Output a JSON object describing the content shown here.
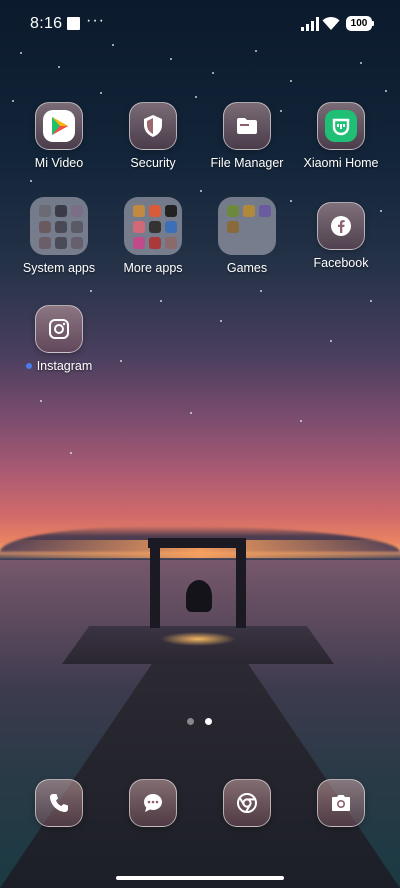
{
  "status_bar": {
    "time": "8:16",
    "more_indicator": "···",
    "battery": "100"
  },
  "apps": [
    {
      "label": "Mi Video",
      "icon": "mi-video-icon"
    },
    {
      "label": "Security",
      "icon": "shield-icon"
    },
    {
      "label": "File Manager",
      "icon": "folder-icon"
    },
    {
      "label": "Xiaomi Home",
      "icon": "xiaomi-home-icon"
    },
    {
      "label": "System apps",
      "icon": "folder-grid-icon"
    },
    {
      "label": "More apps",
      "icon": "folder-grid-icon"
    },
    {
      "label": "Games",
      "icon": "folder-grid-icon"
    },
    {
      "label": "Facebook",
      "icon": "facebook-icon"
    },
    {
      "label": "Instagram",
      "icon": "instagram-icon",
      "new_badge": true
    }
  ],
  "dock": [
    {
      "icon": "phone-icon"
    },
    {
      "icon": "messages-icon"
    },
    {
      "icon": "chrome-icon"
    },
    {
      "icon": "camera-icon"
    }
  ],
  "page_indicator": {
    "pages": 2,
    "current": 2
  },
  "colors": {
    "new_badge": "#4a7cf0",
    "mi_video_tile": "#ffffff",
    "xiaomi_home_tile": "#1fbf76"
  }
}
